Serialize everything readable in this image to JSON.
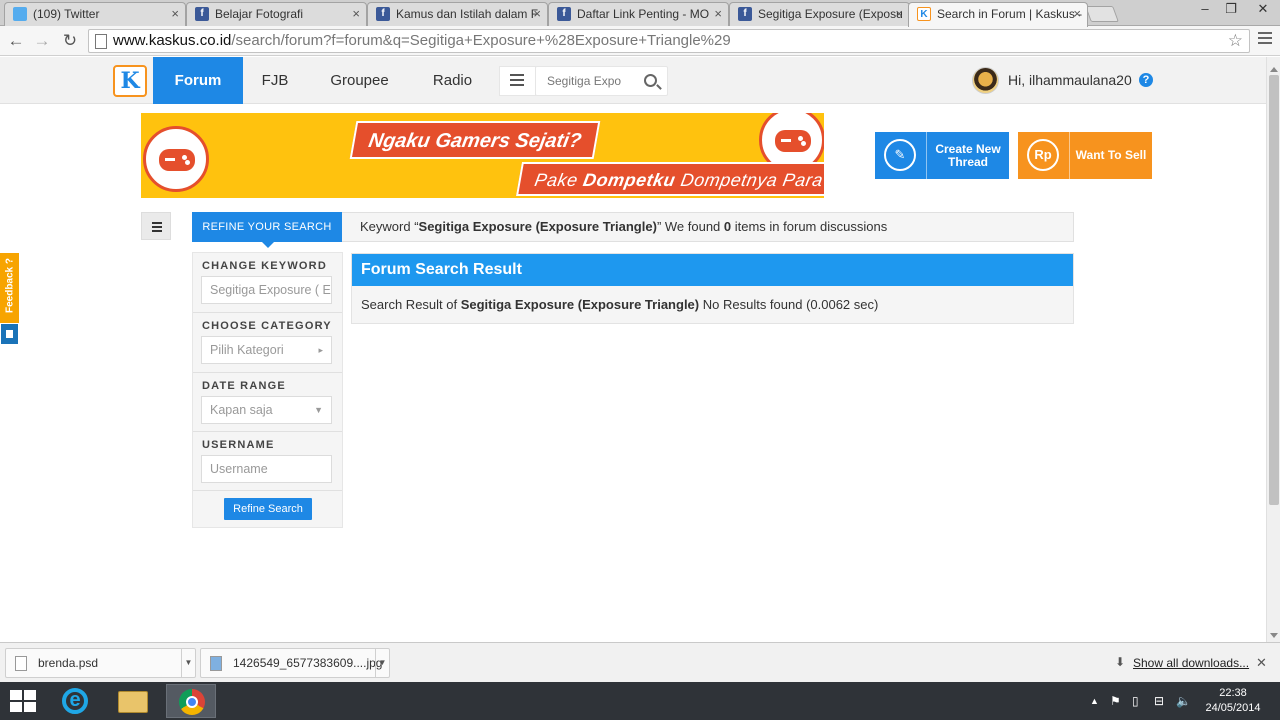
{
  "browser": {
    "tabs": [
      {
        "title": "(109) Twitter",
        "icon": "twitter-icon"
      },
      {
        "title": "Belajar Fotografi",
        "icon": "facebook-icon"
      },
      {
        "title": "Kamus dan Istilah dalam F",
        "icon": "facebook-icon"
      },
      {
        "title": "Daftar Link Penting - MO",
        "icon": "facebook-icon"
      },
      {
        "title": "Segitiga Exposure (Exposu",
        "icon": "facebook-icon"
      },
      {
        "title": "Search in Forum | Kaskus -",
        "icon": "kaskus-icon"
      }
    ],
    "url_host": "www.kaskus.co.id",
    "url_path": "/search/forum?f=forum&q=Segitiga+Exposure+%28Exposure+Triangle%29"
  },
  "header": {
    "logo_text": "K",
    "nav": [
      "Forum",
      "FJB",
      "Groupee",
      "Radio"
    ],
    "search_value": "Segitiga Expo",
    "greeting": "Hi, ilhammaulana20",
    "help_symbol": "?"
  },
  "banner": {
    "line1": "Ngaku Gamers Sejati?",
    "line2_prefix": "Pake ",
    "line2_bold": "Dompetku",
    "line2_suffix": " Dompetnya Para Gamers"
  },
  "actions": {
    "create": {
      "line1": "Create New",
      "line2": "Thread"
    },
    "sell": {
      "label": "Want To Sell",
      "icon_text": "Rp"
    }
  },
  "search": {
    "refine_tab": "REFINE YOUR SEARCH",
    "summary_prefix": "Keyword “",
    "summary_keyword": "Segitiga Exposure (Exposure Triangle)",
    "summary_mid": "” We found ",
    "summary_count": "0",
    "summary_suffix": " items in forum discussions",
    "sidebar": {
      "change_keyword": "CHANGE KEYWORD",
      "keyword_value": "Segitiga Exposure ( E",
      "choose_category": "CHOOSE CATEGORY",
      "category_placeholder": "Pilih Kategori",
      "date_range": "DATE RANGE",
      "date_value": "Kapan saja",
      "username": "USERNAME",
      "username_placeholder": "Username",
      "refine_button": "Refine Search"
    },
    "result": {
      "title": "Forum Search Result",
      "prefix": "Search Result of ",
      "keyword": "Segitiga Exposure (Exposure Triangle)",
      "suffix": " No Results found (0.0062 sec)"
    }
  },
  "feedback": "Feedback ?",
  "downloads": {
    "items": [
      "brenda.psd",
      "1426549_6577383609....jpg"
    ],
    "show_all": "Show all downloads..."
  },
  "taskbar": {
    "time": "22:38",
    "date": "24/05/2014"
  },
  "colors": {
    "brand_blue": "#1e88e5",
    "brand_orange": "#f7931e",
    "banner_yellow": "#ffc20e",
    "banner_red": "#e54f2c"
  }
}
